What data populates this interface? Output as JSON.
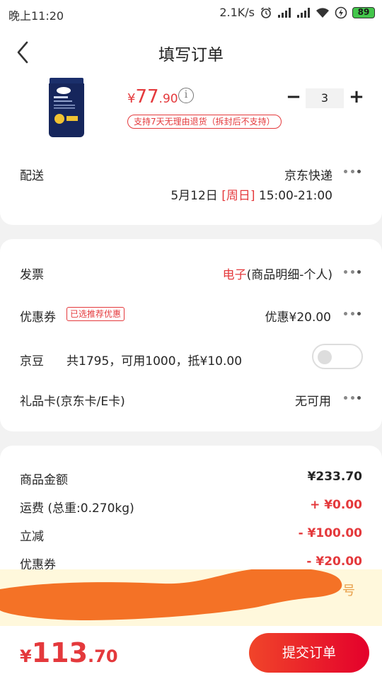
{
  "status_bar": {
    "time": "晚上11:20",
    "network_speed": "2.1K/s",
    "battery": "89"
  },
  "nav": {
    "title": "填写订单"
  },
  "product": {
    "price_symbol": "¥",
    "price_int": "77",
    "price_dec": ".90",
    "quantity": "3",
    "return_policy": "支持7天无理由退货（拆封后不支持）",
    "minus_label": "−",
    "plus_label": "+"
  },
  "delivery": {
    "label": "配送",
    "carrier": "京东快递",
    "date": "5月12日",
    "weekday": "[周日]",
    "time_slot": "15:00-21:00"
  },
  "invoice": {
    "label": "发票",
    "type": "电子",
    "detail": "(商品明细-个人)"
  },
  "coupon": {
    "label": "优惠券",
    "tag": "已选推荐优惠",
    "value": "优惠¥20.00"
  },
  "jingdou": {
    "label": "京豆",
    "detail": "共1795，可用1000，抵¥10.00",
    "enabled": false
  },
  "gift_card": {
    "label": "礼品卡(京东卡/E卡)",
    "value": "无可用"
  },
  "summary": {
    "items": [
      {
        "label": "商品金额",
        "value": "¥233.70"
      },
      {
        "label": "运费 (总重:0.270kg)",
        "value": "+ ¥0.00"
      },
      {
        "label": "立减",
        "value": "- ¥100.00"
      },
      {
        "label": "优惠券",
        "value": "- ¥20.00"
      }
    ]
  },
  "notice": {
    "visible_text": "号"
  },
  "footer": {
    "total_symbol": "¥",
    "total_int": "113",
    "total_dec": ".70",
    "submit_label": "提交订单"
  },
  "colors": {
    "accent": "#e4393c",
    "notice_bg": "#fff8dc",
    "redaction": "#f47226"
  }
}
